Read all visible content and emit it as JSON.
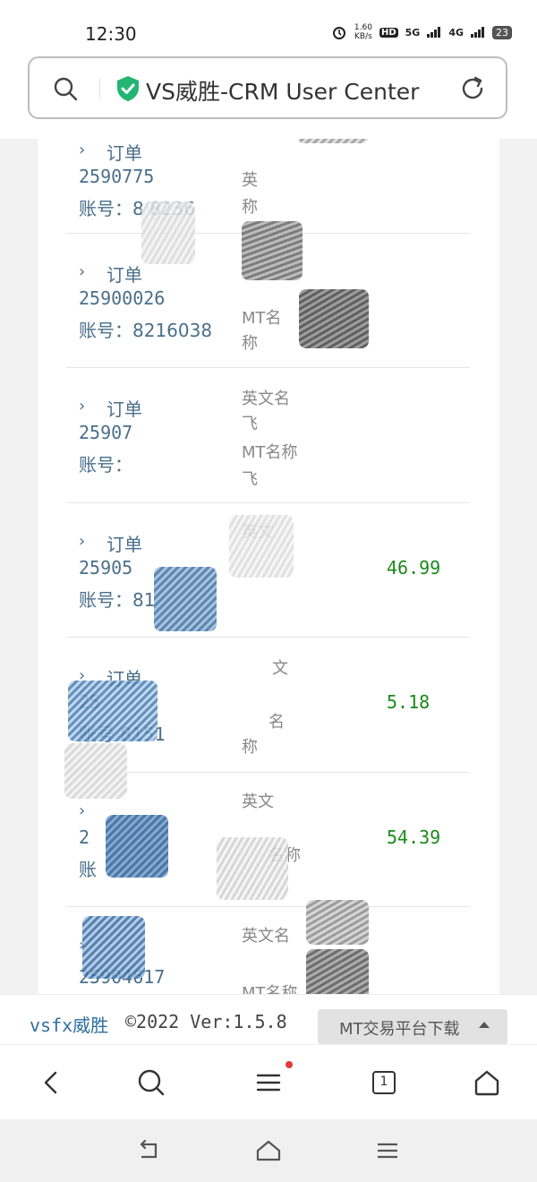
{
  "status": {
    "time": "12:30",
    "speed_value": "1.60",
    "speed_unit": "KB/s",
    "hd_label": "HD",
    "net1": "5G",
    "net2": "4G",
    "battery": "23"
  },
  "url_bar": {
    "title": "VS威胜-CRM User Center"
  },
  "orders": [
    {
      "label": "订单",
      "id": "2590775",
      "account": "账号：8 8236",
      "lines": [
        "英",
        "称"
      ],
      "profit": ""
    },
    {
      "label": "订单",
      "id": "25900026",
      "account": "账号：8216038",
      "lines": [
        "",
        "MT名",
        "称"
      ],
      "profit": ""
    },
    {
      "label": "订单",
      "id": "25907",
      "account": "账号：",
      "lines": [
        "英文名",
        "飞",
        "MT名称",
        "飞"
      ],
      "profit": ""
    },
    {
      "label": "订单",
      "id": "25905",
      "account": "账号：81",
      "lines": [
        "英文"
      ],
      "profit": "46.99"
    },
    {
      "label": "订单",
      "id": "25",
      "account": "账号 8151",
      "lines": [
        "文",
        "名",
        "称"
      ],
      "profit": "5.18"
    },
    {
      "label": "",
      "id": "2",
      "account": "账",
      "lines": [
        "英文",
        "名称"
      ],
      "profit": "54.39"
    },
    {
      "label": "",
      "id": "25904617",
      "account": "",
      "lines": [
        "英文名",
        "",
        "MT名称"
      ],
      "profit": ""
    }
  ],
  "footer": {
    "brand": "vsfx威胜",
    "copyright": "©2022 Ver:1.5.8",
    "download_label": "MT交易平台下载"
  },
  "icons": {
    "search": "search-icon",
    "shield": "shield-check-icon",
    "reload": "reload-icon",
    "back": "back-icon",
    "toolbar_search": "search-icon",
    "menu": "menu-icon",
    "tabs": "tabs-icon",
    "home": "home-icon"
  },
  "toolbar": {
    "tab_count": "1"
  },
  "colors": {
    "link_blue": "#4a6f8a",
    "profit_green": "#1a8a1a",
    "shield_green": "#22b573",
    "notification_red": "#e53935"
  }
}
